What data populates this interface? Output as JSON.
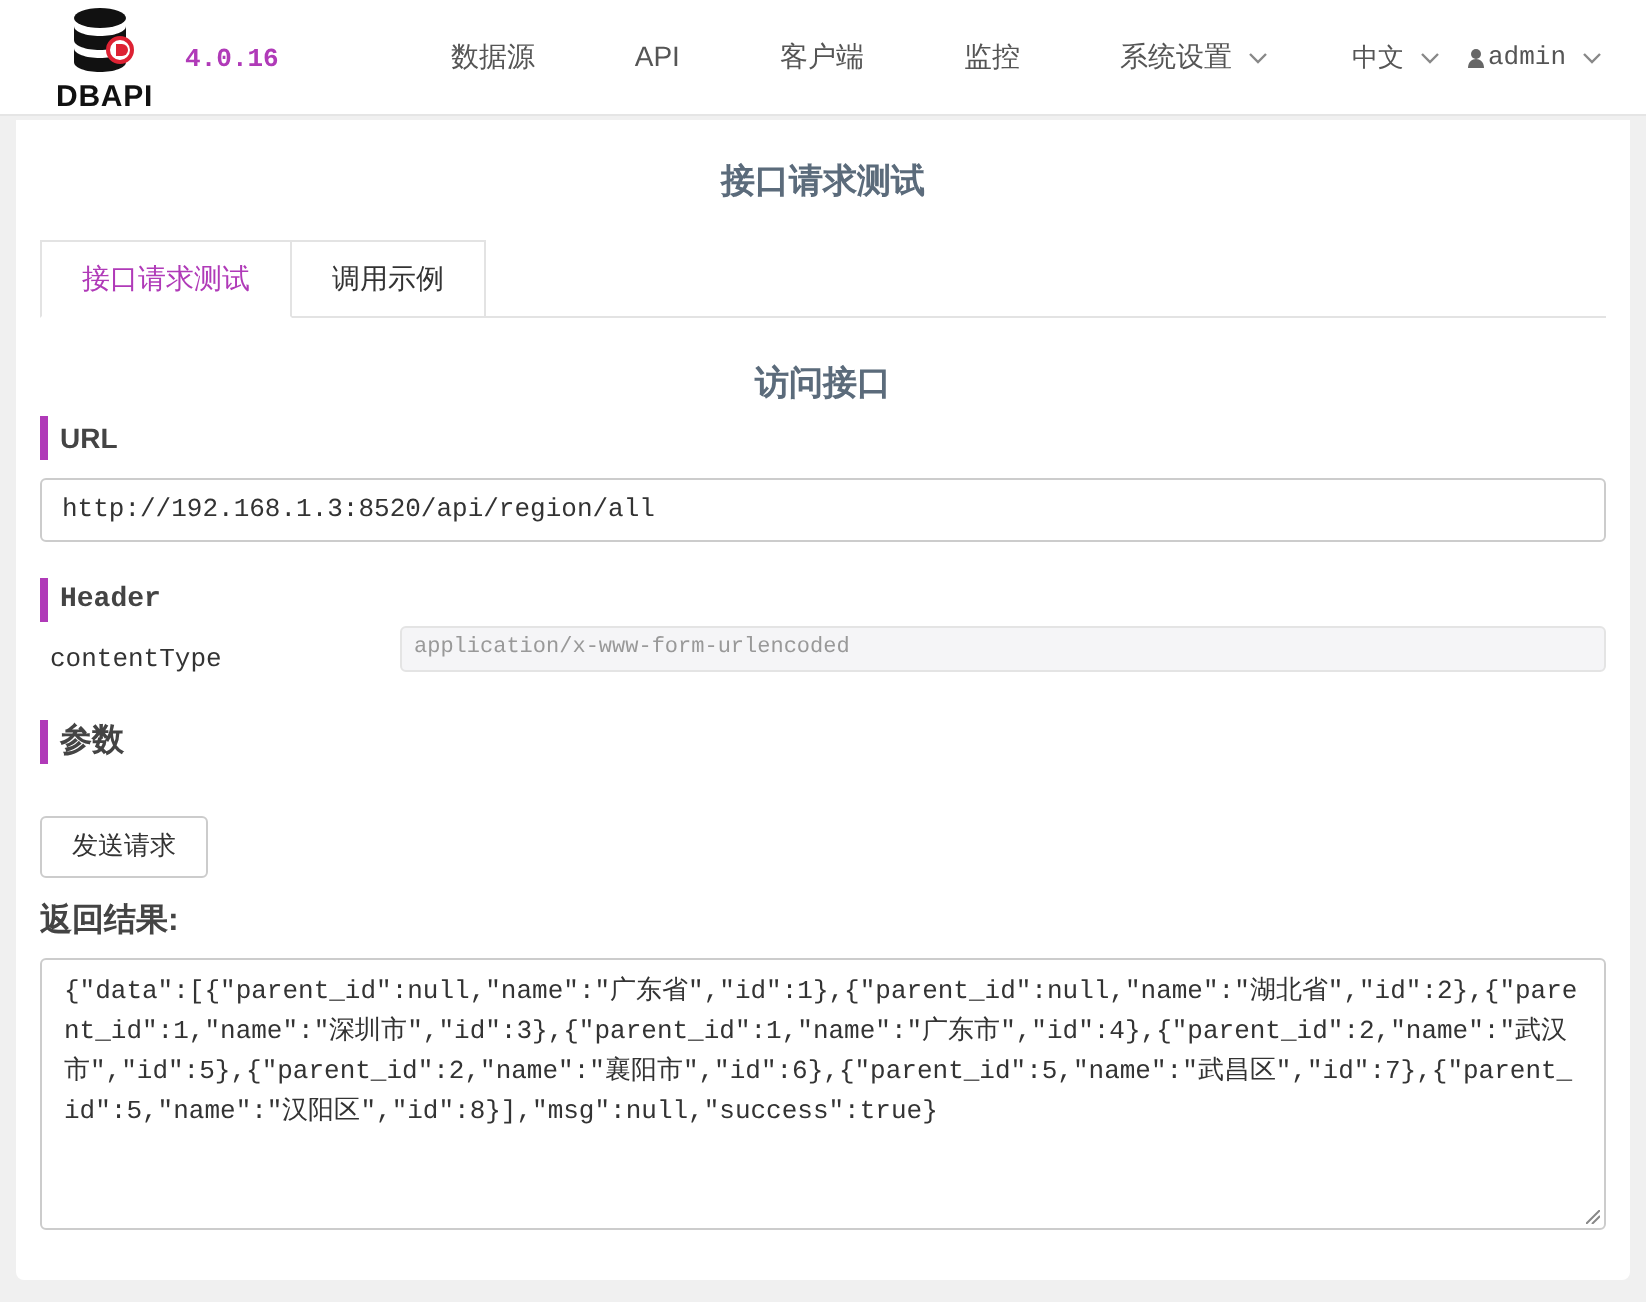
{
  "header": {
    "logo_text": "DBAPI",
    "version": "4.0.16",
    "nav": [
      {
        "label": "数据源",
        "dropdown": false
      },
      {
        "label": "API",
        "dropdown": false
      },
      {
        "label": "客户端",
        "dropdown": false
      },
      {
        "label": "监控",
        "dropdown": false
      },
      {
        "label": "系统设置",
        "dropdown": true
      }
    ],
    "language": "中文",
    "user": "admin"
  },
  "page_title": "接口请求测试",
  "tabs": [
    {
      "label": "接口请求测试",
      "selected": true
    },
    {
      "label": "调用示例",
      "selected": false
    }
  ],
  "section_title": "访问接口",
  "url": {
    "label": "URL",
    "value": "http://192.168.1.3:8520/api/region/all"
  },
  "header_section": {
    "label": "Header",
    "params": [
      {
        "name": "contentType",
        "value": "application/x-www-form-urlencoded"
      }
    ]
  },
  "params_section": {
    "label": "参数"
  },
  "send_button": "发送请求",
  "result": {
    "label": "返回结果:",
    "value": "{\"data\":[{\"parent_id\":null,\"name\":\"广东省\",\"id\":1},{\"parent_id\":null,\"name\":\"湖北省\",\"id\":2},{\"parent_id\":1,\"name\":\"深圳市\",\"id\":3},{\"parent_id\":1,\"name\":\"广东市\",\"id\":4},{\"parent_id\":2,\"name\":\"武汉市\",\"id\":5},{\"parent_id\":2,\"name\":\"襄阳市\",\"id\":6},{\"parent_id\":5,\"name\":\"武昌区\",\"id\":7},{\"parent_id\":5,\"name\":\"汉阳区\",\"id\":8}],\"msg\":null,\"success\":true}"
  }
}
